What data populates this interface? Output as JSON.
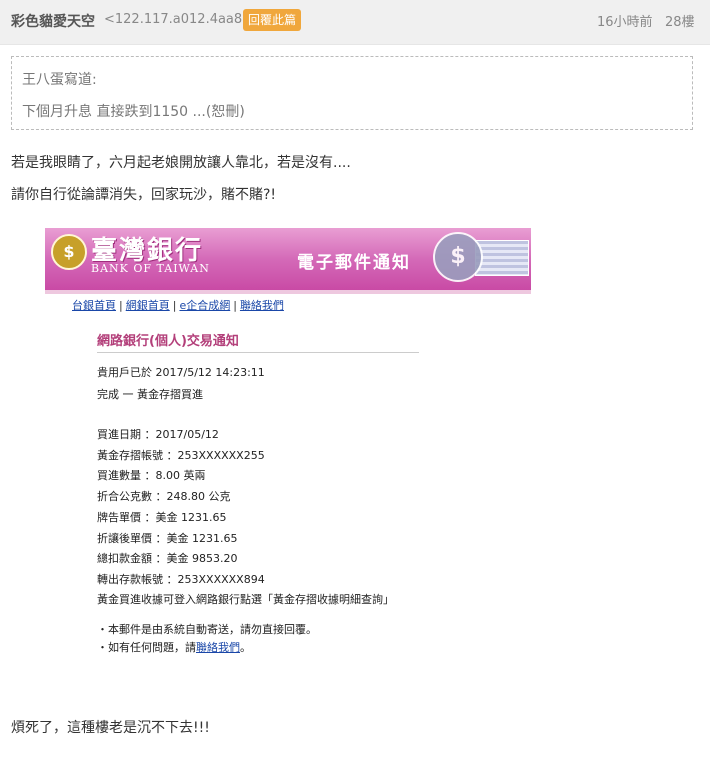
{
  "header": {
    "username": "彩色貓愛天空",
    "ip": "<122.117.a012.4aa8>",
    "reply_label": "回覆此篇",
    "time": "16小時前",
    "floor": "28樓"
  },
  "quote": {
    "author": "王八蛋寫道:",
    "text": "下個月升息 直接跌到1150 ...(恕刪)"
  },
  "post": {
    "line1": "若是我眼睛了，六月起老娘開放讓人靠北，若是沒有....",
    "line2": "請你自行從論譚消失，回家玩沙，賭不賭?!",
    "closing": "煩死了，這種樓老是沉不下去!!!"
  },
  "email": {
    "bank_name_zh": "臺灣銀行",
    "bank_name_en": "BANK OF TAIWAN",
    "banner_title": "電子郵件通知",
    "nav": [
      "台銀首頁",
      "網銀首頁",
      "e企合成網",
      "聯絡我們"
    ],
    "notice_title": "網路銀行(個人)交易通知",
    "lines": [
      "貴用戶已於 2017/5/12 14:23:11",
      "完成 一 黃金存摺買進",
      "買進日期 ：2017/05/12",
      "黃金存摺帳號 ：253XXXXXX255",
      "買進數量 ：8.00 英兩",
      "折合公克數 ：248.80 公克",
      "牌告單價 ：美金 1231.65",
      "折讓後單價 ：美金 1231.65",
      "總扣款金額 ：美金 9853.20",
      "轉出存款帳號 ：253XXXXXX894",
      "黃金買進收據可登入網路銀行點選「黃金存摺收據明細查詢」"
    ],
    "note1": "・本郵件是由系統自動寄送，請勿直接回覆。",
    "note2_prefix": "・如有任何問題，請",
    "note2_link": "聯絡我們",
    "note2_suffix": "。"
  },
  "colors": {
    "accent": "#f0a73c",
    "banner": "#d46ab8",
    "notice_title": "#b33f7a",
    "link": "#1a47a8"
  }
}
